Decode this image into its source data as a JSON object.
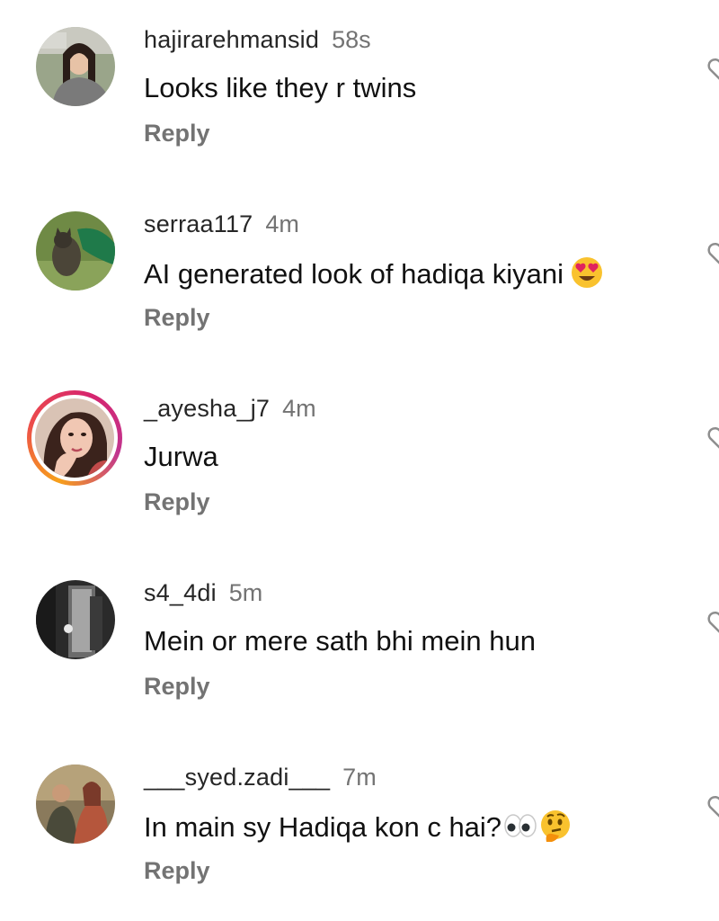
{
  "comments": [
    {
      "username": "hajirarehmansid",
      "time": "58s",
      "text": "Looks like they r twins",
      "reply_label": "Reply"
    },
    {
      "username": "serraa117",
      "time": "4m",
      "text": "AI generated look of hadiqa kiyani",
      "reply_label": "Reply",
      "emoji": "heart-eyes-emoji"
    },
    {
      "username": "_ayesha_j7",
      "time": "4m",
      "text": "Jurwa",
      "reply_label": "Reply",
      "story_ring": true
    },
    {
      "username": "s4_4di",
      "time": "5m",
      "text": "Mein or mere sath bhi mein hun",
      "reply_label": "Reply"
    },
    {
      "username": "___syed.zadi___",
      "time": "7m",
      "text": "In main sy Hadiqa kon c hai?",
      "reply_label": "Reply",
      "emoji": [
        "eyes-emoji",
        "thinking-face-emoji"
      ]
    }
  ],
  "colors": {
    "secondary_text": "#737373",
    "primary_text": "#111111",
    "story_ring_start": "#f7a01b",
    "story_ring_end": "#c1358f"
  }
}
